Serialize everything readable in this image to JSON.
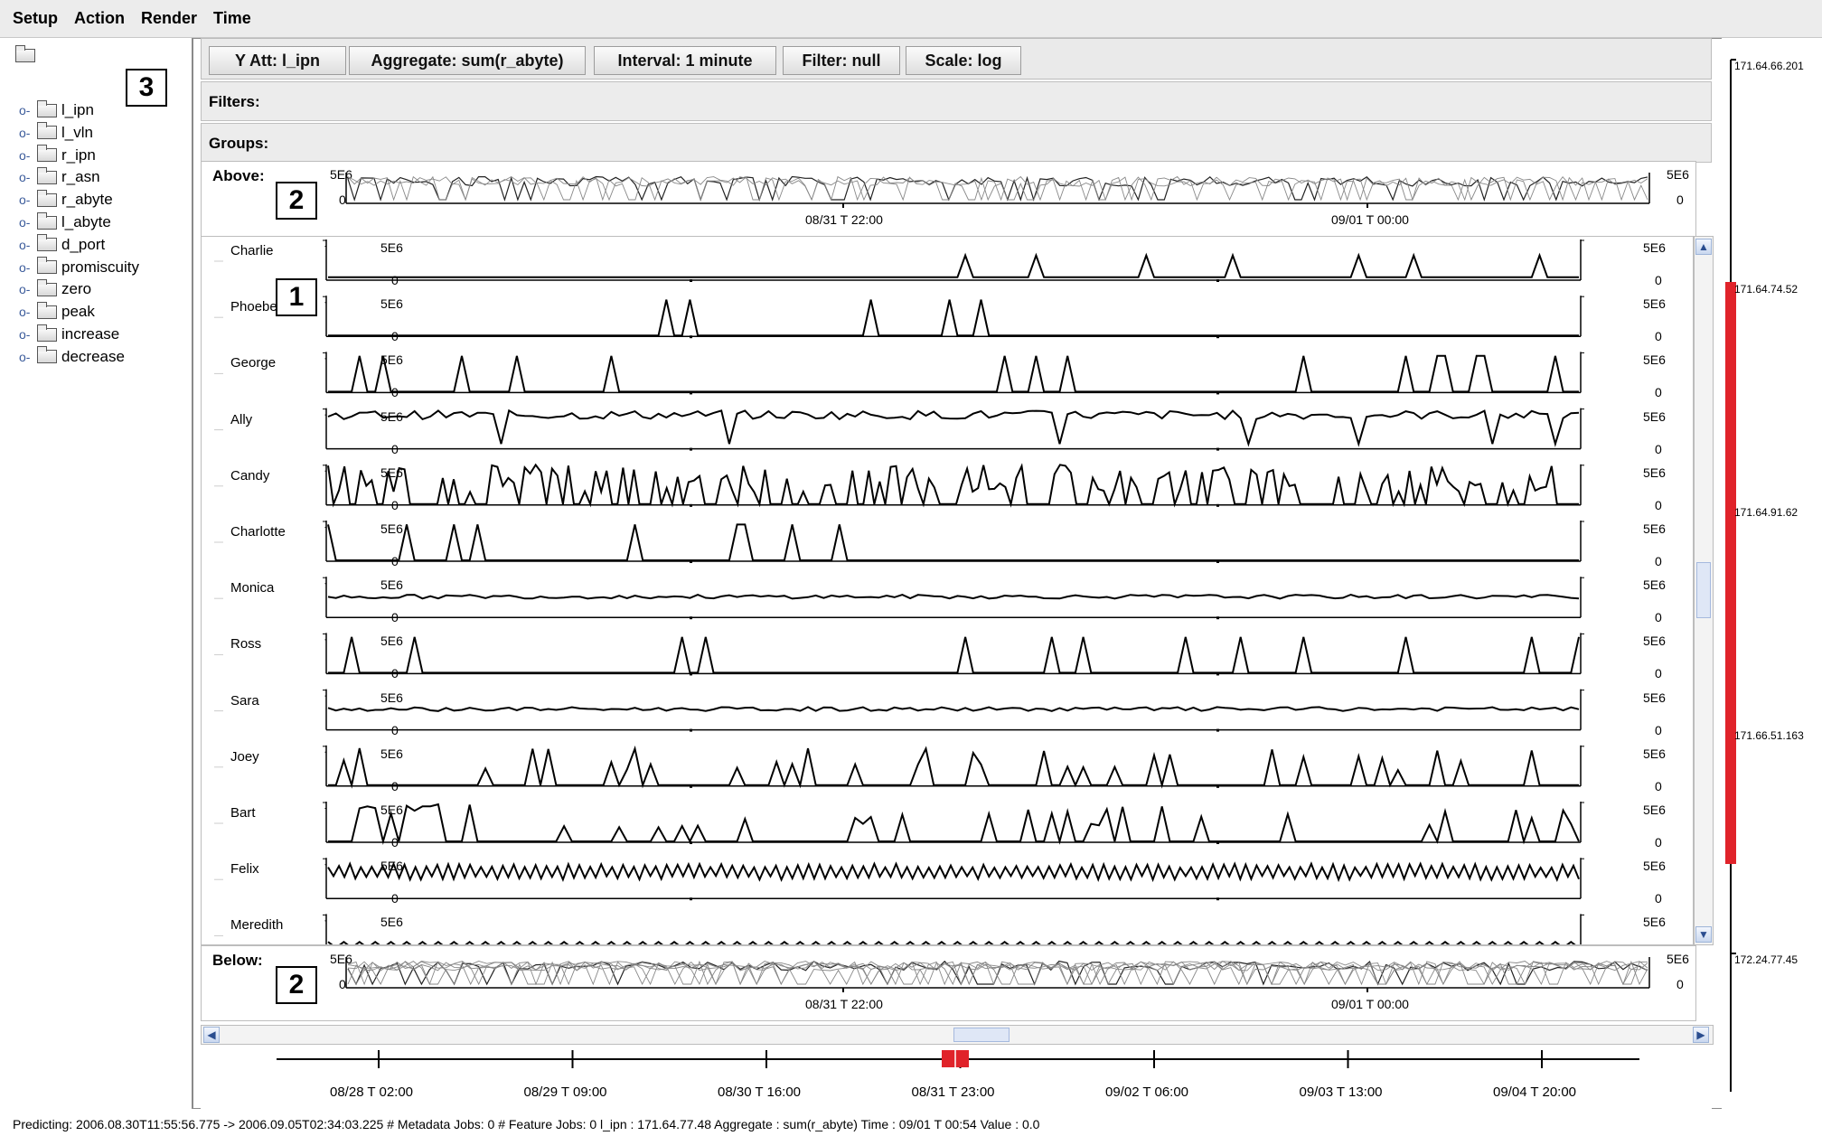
{
  "menu": [
    "Setup",
    "Action",
    "Render",
    "Time"
  ],
  "tree": {
    "items": [
      "l_ipn",
      "l_vln",
      "r_ipn",
      "r_asn",
      "r_abyte",
      "l_abyte",
      "d_port",
      "promiscuity",
      "zero",
      "peak",
      "increase",
      "decrease"
    ]
  },
  "callouts": {
    "tree": "3",
    "above": "2",
    "rows": "1",
    "below": "2"
  },
  "toolbar": {
    "y_att": "Y Att: l_ipn",
    "aggregate": "Aggregate: sum(r_abyte)",
    "interval": "Interval: 1 minute",
    "filter": "Filter: null",
    "scale": "Scale: log"
  },
  "filters_label": "Filters:",
  "groups_label": "Groups:",
  "above": {
    "label": "Above:",
    "ymax": "5E6",
    "ymin": "0",
    "ymax_r": "5E6",
    "ymin_r": "0",
    "t1": "08/31 T 22:00",
    "t2": "09/01 T 00:00"
  },
  "below": {
    "label": "Below:",
    "ymax": "5E6",
    "ymin": "0",
    "ymax_r": "5E6",
    "ymin_r": "0",
    "t1": "08/31 T 22:00",
    "t2": "09/01 T 00:00"
  },
  "rows": [
    {
      "name": "Charlie",
      "style": "flat"
    },
    {
      "name": "Phoebe",
      "style": "spikes"
    },
    {
      "name": "George",
      "style": "spikes"
    },
    {
      "name": "Ally",
      "style": "high"
    },
    {
      "name": "Candy",
      "style": "dense"
    },
    {
      "name": "Charlotte",
      "style": "spikes"
    },
    {
      "name": "Monica",
      "style": "midflat"
    },
    {
      "name": "Ross",
      "style": "spikes"
    },
    {
      "name": "Sara",
      "style": "midflat"
    },
    {
      "name": "Joey",
      "style": "medium"
    },
    {
      "name": "Bart",
      "style": "medium"
    },
    {
      "name": "Felix",
      "style": "zigzag"
    },
    {
      "name": "Meredith",
      "style": "lowzig"
    }
  ],
  "row_ytick": {
    "max": "5E6",
    "min": "0"
  },
  "timeline": [
    "08/28 T 02:00",
    "08/29 T 09:00",
    "08/30 T 16:00",
    "08/31 T 23:00",
    "09/02 T 06:00",
    "09/03 T 13:00",
    "09/04 T 20:00"
  ],
  "ip_axis": [
    "171.64.66.201",
    "171.64.74.52",
    "171.64.91.62",
    "171.66.51.163",
    "172.24.77.45"
  ],
  "status": "Predicting:   2006.08.30T11:55:56.775 -> 2006.09.05T02:34:03.225   # Metadata Jobs:   0    # Feature Jobs:   0    l_ipn :  171.64.77.48   Aggregate :  sum(r_abyte)   Time :  09/01 T 00:54   Value :  0.0",
  "colors": {
    "highlight": "#e0232a",
    "panel": "#ececec"
  }
}
